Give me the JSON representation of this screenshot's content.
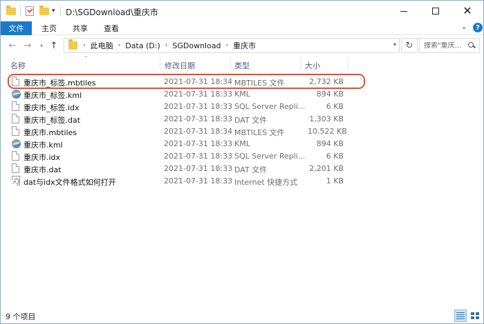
{
  "window": {
    "title": "D:\\SGDownload\\重庆市",
    "minimize_icon": "minimize-icon",
    "maximize_icon": "maximize-icon",
    "close_icon": "close-icon"
  },
  "quick_access": {
    "icons": [
      "folder-icon",
      "properties-check-icon",
      "new-folder-icon",
      "customize-dropdown-icon"
    ]
  },
  "ribbon": {
    "tabs": [
      {
        "label": "文件",
        "active": true
      },
      {
        "label": "主页"
      },
      {
        "label": "共享"
      },
      {
        "label": "查看"
      }
    ],
    "collapse_icon": "chevron-down-icon",
    "help_label": "?",
    "accent_color": "#1979ca"
  },
  "navigation": {
    "breadcrumbs": [
      "此电脑",
      "Data (D:)",
      "SGDownload",
      "重庆市"
    ],
    "search_placeholder": "搜索\"重庆...",
    "icons": [
      "back-arrow-icon",
      "forward-arrow-icon",
      "recent-dropdown-icon",
      "up-arrow-icon",
      "refresh-icon",
      "search-icon"
    ]
  },
  "columns": {
    "name": "名称",
    "date": "修改日期",
    "type": "类型",
    "size": "大小"
  },
  "files": [
    {
      "name": "重庆市_标签.mbtiles",
      "date": "2021-07-31 18:34",
      "type": "MBTILES 文件",
      "size": "2,732 KB",
      "icon": "document-icon",
      "highlighted": true
    },
    {
      "name": "重庆市_标签.kml",
      "date": "2021-07-31 18:33",
      "type": "KML",
      "size": "894 KB",
      "icon": "kml-globe-icon"
    },
    {
      "name": "重庆市_标签.idx",
      "date": "2021-07-31 18:33",
      "type": "SQL Server Repli...",
      "size": "6 KB",
      "icon": "document-icon"
    },
    {
      "name": "重庆市_标签.dat",
      "date": "2021-07-31 18:33",
      "type": "DAT 文件",
      "size": "1,303 KB",
      "icon": "document-icon"
    },
    {
      "name": "重庆市.mbtiles",
      "date": "2021-07-31 18:34",
      "type": "MBTILES 文件",
      "size": "10,522 KB",
      "icon": "document-icon"
    },
    {
      "name": "重庆市.kml",
      "date": "2021-07-31 18:33",
      "type": "KML",
      "size": "894 KB",
      "icon": "kml-globe-icon"
    },
    {
      "name": "重庆市.idx",
      "date": "2021-07-31 18:33",
      "type": "SQL Server Repli...",
      "size": "6 KB",
      "icon": "document-icon"
    },
    {
      "name": "重庆市.dat",
      "date": "2021-07-31 18:33",
      "type": "DAT 文件",
      "size": "2,201 KB",
      "icon": "document-icon"
    },
    {
      "name": "dat与idx文件格式如何打开",
      "date": "2021-07-31 18:33",
      "type": "Internet 快捷方式",
      "size": "1 KB",
      "icon": "internet-shortcut-icon"
    }
  ],
  "highlight_color": "#d4533f",
  "status": {
    "item_count": "9 个项目",
    "view_icons": [
      "details-view-icon",
      "large-icons-view-icon"
    ]
  }
}
